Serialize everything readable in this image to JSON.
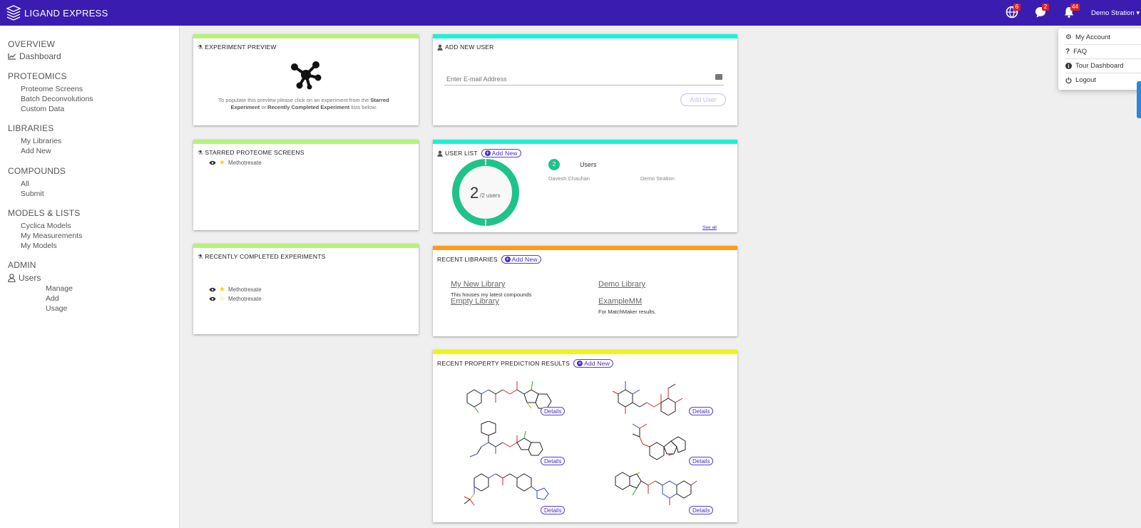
{
  "app": {
    "brand": "LIGAND EXPRESS"
  },
  "topbar": {
    "badges": {
      "globe": "6",
      "chat": "2",
      "bell": "44"
    },
    "user_name": "Demo Stration"
  },
  "dropdown": {
    "items": [
      {
        "label": "My Account",
        "icon": "gear-icon"
      },
      {
        "label": "FAQ",
        "icon": "question-icon"
      },
      {
        "label": "Tour Dashboard",
        "icon": "info-icon"
      },
      {
        "label": "Logout",
        "icon": "power-icon"
      }
    ]
  },
  "sidebar": {
    "overview": "OVERVIEW",
    "dashboard": "Dashboard",
    "proteomics": "PROTEOMICS",
    "proteomics_items": [
      "Proteome Screens",
      "Batch Deconvolutions",
      "Custom Data"
    ],
    "libraries": "LIBRARIES",
    "libraries_items": [
      "My Libraries",
      "Add New"
    ],
    "compounds": "COMPOUNDS",
    "compounds_items": [
      "All",
      "Submit"
    ],
    "models": "MODELS & LISTS",
    "models_items": [
      "Cyclica Models",
      "My Measurements",
      "My Models"
    ],
    "admin": "ADMIN",
    "users": "Users",
    "users_items": [
      "Manage",
      "Add",
      "Usage"
    ]
  },
  "experiment_preview": {
    "title": "EXPERIMENT PREVIEW",
    "text_before": "To populate this preview please click on an experiment from the ",
    "starred": "Starred Experiment",
    "or": " or ",
    "recent": "Recently Completed Experiment",
    "text_after": " lists below."
  },
  "starred_screens": {
    "title": "STARRED PROTEOME SCREENS",
    "items": [
      {
        "name": "Methotrexate",
        "starred": true
      }
    ]
  },
  "recent_experiments": {
    "title": "RECENTLY COMPLETED EXPERIMENTS",
    "items": [
      {
        "name": "Methotrexate",
        "starred": true
      },
      {
        "name": "Methotrexate",
        "starred": false
      }
    ]
  },
  "add_user": {
    "title": "ADD NEW USER",
    "placeholder": "Enter E-mail Address",
    "button": "Add User"
  },
  "user_list": {
    "title": "USER LIST",
    "add_new": "Add New",
    "donut_value": "2",
    "donut_sub": "/2 users",
    "count": "2",
    "users_label": "Users",
    "users": [
      "Davesh Chauhan",
      "Demo Stration"
    ],
    "see_all": "See all"
  },
  "recent_libraries": {
    "title": "RECENT LIBRARIES",
    "add_new": "Add New",
    "libraries": [
      {
        "name": "My New Library",
        "desc": "This houses my latest compounds"
      },
      {
        "name": "Demo Library",
        "desc": ""
      },
      {
        "name": "Empty Library",
        "desc": ""
      },
      {
        "name": "ExampleMM",
        "desc": "For MatchMaker results."
      }
    ]
  },
  "property_predictions": {
    "title": "RECENT PROPERTY PREDICTION RESULTS",
    "add_new": "Add New",
    "details_label": "Details"
  },
  "colors": {
    "topbar": "#3a1db0",
    "bar_green": "#b6f27a",
    "bar_cyan": "#1af2d6",
    "bar_orange": "#ff9a1a",
    "bar_yellow": "#f2f21a",
    "donut": "#1fc38a",
    "accent": "#4a2bc6"
  }
}
